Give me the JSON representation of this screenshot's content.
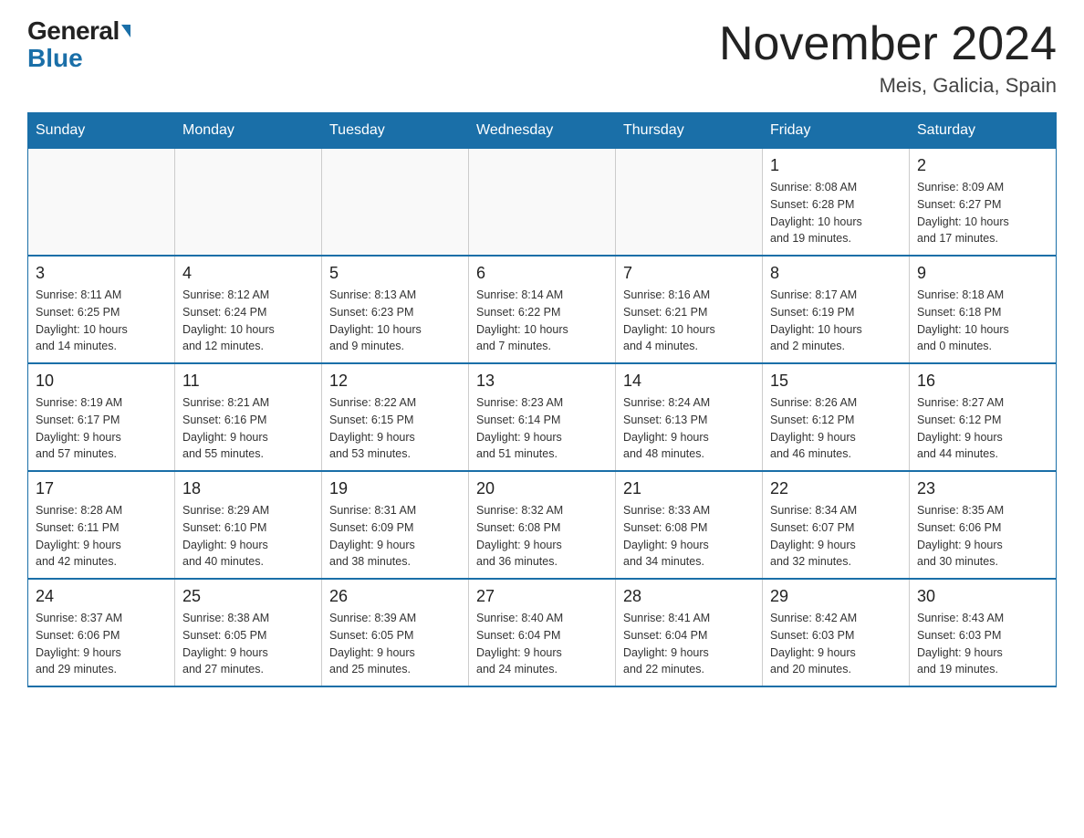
{
  "logo": {
    "text_general": "General",
    "text_blue": "Blue"
  },
  "header": {
    "title": "November 2024",
    "location": "Meis, Galicia, Spain"
  },
  "weekdays": [
    "Sunday",
    "Monday",
    "Tuesday",
    "Wednesday",
    "Thursday",
    "Friday",
    "Saturday"
  ],
  "weeks": [
    [
      {
        "day": "",
        "info": ""
      },
      {
        "day": "",
        "info": ""
      },
      {
        "day": "",
        "info": ""
      },
      {
        "day": "",
        "info": ""
      },
      {
        "day": "",
        "info": ""
      },
      {
        "day": "1",
        "info": "Sunrise: 8:08 AM\nSunset: 6:28 PM\nDaylight: 10 hours\nand 19 minutes."
      },
      {
        "day": "2",
        "info": "Sunrise: 8:09 AM\nSunset: 6:27 PM\nDaylight: 10 hours\nand 17 minutes."
      }
    ],
    [
      {
        "day": "3",
        "info": "Sunrise: 8:11 AM\nSunset: 6:25 PM\nDaylight: 10 hours\nand 14 minutes."
      },
      {
        "day": "4",
        "info": "Sunrise: 8:12 AM\nSunset: 6:24 PM\nDaylight: 10 hours\nand 12 minutes."
      },
      {
        "day": "5",
        "info": "Sunrise: 8:13 AM\nSunset: 6:23 PM\nDaylight: 10 hours\nand 9 minutes."
      },
      {
        "day": "6",
        "info": "Sunrise: 8:14 AM\nSunset: 6:22 PM\nDaylight: 10 hours\nand 7 minutes."
      },
      {
        "day": "7",
        "info": "Sunrise: 8:16 AM\nSunset: 6:21 PM\nDaylight: 10 hours\nand 4 minutes."
      },
      {
        "day": "8",
        "info": "Sunrise: 8:17 AM\nSunset: 6:19 PM\nDaylight: 10 hours\nand 2 minutes."
      },
      {
        "day": "9",
        "info": "Sunrise: 8:18 AM\nSunset: 6:18 PM\nDaylight: 10 hours\nand 0 minutes."
      }
    ],
    [
      {
        "day": "10",
        "info": "Sunrise: 8:19 AM\nSunset: 6:17 PM\nDaylight: 9 hours\nand 57 minutes."
      },
      {
        "day": "11",
        "info": "Sunrise: 8:21 AM\nSunset: 6:16 PM\nDaylight: 9 hours\nand 55 minutes."
      },
      {
        "day": "12",
        "info": "Sunrise: 8:22 AM\nSunset: 6:15 PM\nDaylight: 9 hours\nand 53 minutes."
      },
      {
        "day": "13",
        "info": "Sunrise: 8:23 AM\nSunset: 6:14 PM\nDaylight: 9 hours\nand 51 minutes."
      },
      {
        "day": "14",
        "info": "Sunrise: 8:24 AM\nSunset: 6:13 PM\nDaylight: 9 hours\nand 48 minutes."
      },
      {
        "day": "15",
        "info": "Sunrise: 8:26 AM\nSunset: 6:12 PM\nDaylight: 9 hours\nand 46 minutes."
      },
      {
        "day": "16",
        "info": "Sunrise: 8:27 AM\nSunset: 6:12 PM\nDaylight: 9 hours\nand 44 minutes."
      }
    ],
    [
      {
        "day": "17",
        "info": "Sunrise: 8:28 AM\nSunset: 6:11 PM\nDaylight: 9 hours\nand 42 minutes."
      },
      {
        "day": "18",
        "info": "Sunrise: 8:29 AM\nSunset: 6:10 PM\nDaylight: 9 hours\nand 40 minutes."
      },
      {
        "day": "19",
        "info": "Sunrise: 8:31 AM\nSunset: 6:09 PM\nDaylight: 9 hours\nand 38 minutes."
      },
      {
        "day": "20",
        "info": "Sunrise: 8:32 AM\nSunset: 6:08 PM\nDaylight: 9 hours\nand 36 minutes."
      },
      {
        "day": "21",
        "info": "Sunrise: 8:33 AM\nSunset: 6:08 PM\nDaylight: 9 hours\nand 34 minutes."
      },
      {
        "day": "22",
        "info": "Sunrise: 8:34 AM\nSunset: 6:07 PM\nDaylight: 9 hours\nand 32 minutes."
      },
      {
        "day": "23",
        "info": "Sunrise: 8:35 AM\nSunset: 6:06 PM\nDaylight: 9 hours\nand 30 minutes."
      }
    ],
    [
      {
        "day": "24",
        "info": "Sunrise: 8:37 AM\nSunset: 6:06 PM\nDaylight: 9 hours\nand 29 minutes."
      },
      {
        "day": "25",
        "info": "Sunrise: 8:38 AM\nSunset: 6:05 PM\nDaylight: 9 hours\nand 27 minutes."
      },
      {
        "day": "26",
        "info": "Sunrise: 8:39 AM\nSunset: 6:05 PM\nDaylight: 9 hours\nand 25 minutes."
      },
      {
        "day": "27",
        "info": "Sunrise: 8:40 AM\nSunset: 6:04 PM\nDaylight: 9 hours\nand 24 minutes."
      },
      {
        "day": "28",
        "info": "Sunrise: 8:41 AM\nSunset: 6:04 PM\nDaylight: 9 hours\nand 22 minutes."
      },
      {
        "day": "29",
        "info": "Sunrise: 8:42 AM\nSunset: 6:03 PM\nDaylight: 9 hours\nand 20 minutes."
      },
      {
        "day": "30",
        "info": "Sunrise: 8:43 AM\nSunset: 6:03 PM\nDaylight: 9 hours\nand 19 minutes."
      }
    ]
  ]
}
